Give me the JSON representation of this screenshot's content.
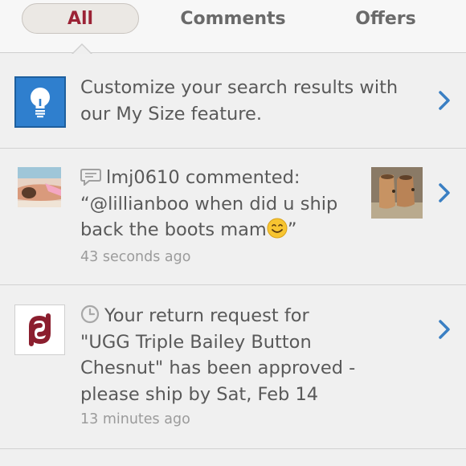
{
  "tabs": {
    "all": "All",
    "comments": "Comments",
    "offers": "Offers"
  },
  "tip": {
    "line1": "Customize your search results with",
    "line2": "our My Size feature."
  },
  "comment": {
    "user": "lmj0610",
    "action": " commented:",
    "line1": "“@lillianboo when did u ship",
    "line2_prefix": "back the boots mam",
    "line2_suffix": "”",
    "time": "43 seconds ago"
  },
  "return": {
    "line1": "Your return request for",
    "line2": "\"UGG Triple Bailey Button",
    "line3": "Chesnut\" has been approved -",
    "line4": "please ship by Sat, Feb 14",
    "time": "13 minutes ago"
  },
  "colors": {
    "brand": "#9b2335",
    "accent": "#2f7fce"
  },
  "icons": [
    "lightbulb-icon",
    "comment-bubble-icon",
    "clock-icon",
    "chevron-right-icon",
    "smiley-icon",
    "poshmark-logo"
  ]
}
